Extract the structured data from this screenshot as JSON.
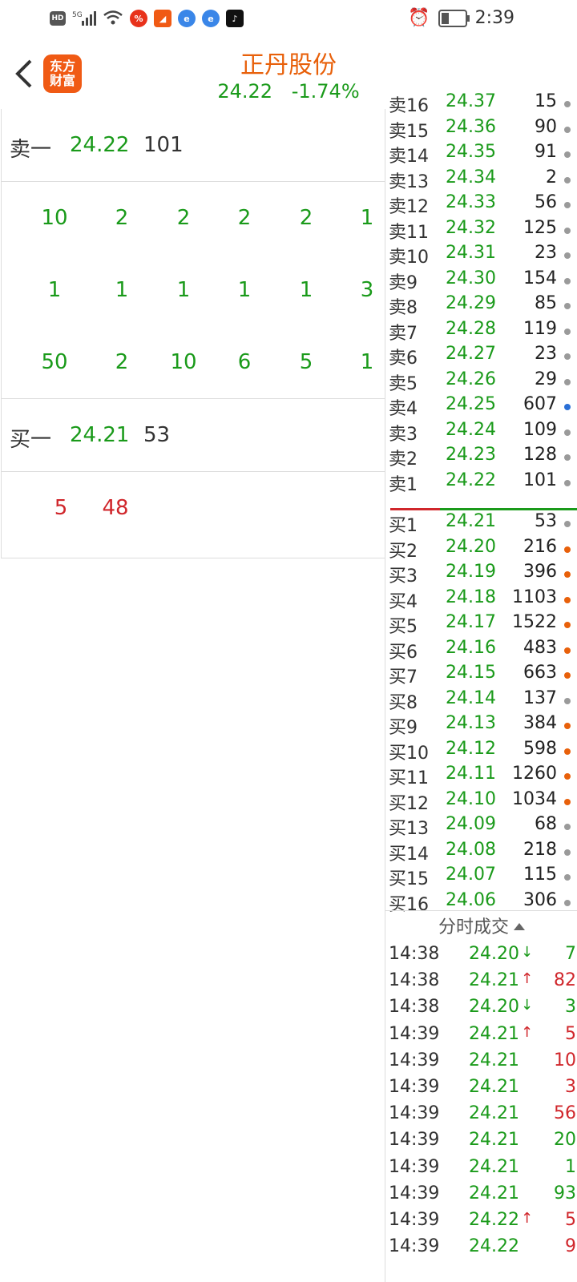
{
  "status_bar": {
    "time": "2:39",
    "left_icons": [
      "hd-icon",
      "5g-signal-icon",
      "wifi-icon",
      "app-icon-1",
      "app-icon-2",
      "app-icon-3",
      "app-icon-4",
      "tiktok-icon"
    ],
    "right_icons": [
      "alarm-icon",
      "battery-icon"
    ]
  },
  "header": {
    "logo_text": "东方\n财富",
    "title": "正丹股份",
    "price": "24.22",
    "change": "-1.74%",
    "title_color": "#e8600a",
    "price_color": "#1a9a1a"
  },
  "left_panel": {
    "sell_row": {
      "label": "卖一",
      "price": "24.22",
      "volume": "101"
    },
    "sell_queue": [
      [
        "10",
        "2",
        "2",
        "2",
        "2",
        "1"
      ],
      [
        "1",
        "1",
        "1",
        "1",
        "1",
        "3"
      ],
      [
        "50",
        "2",
        "10",
        "6",
        "5",
        "1"
      ]
    ],
    "buy_row": {
      "label": "买一",
      "price": "24.21",
      "volume": "53"
    },
    "buy_queue": [
      [
        "5",
        "48"
      ]
    ]
  },
  "order_book": {
    "sells": [
      {
        "label": "卖16",
        "price": "24.37",
        "volume": "15",
        "dot": "gray"
      },
      {
        "label": "卖15",
        "price": "24.36",
        "volume": "90",
        "dot": "gray"
      },
      {
        "label": "卖14",
        "price": "24.35",
        "volume": "91",
        "dot": "gray"
      },
      {
        "label": "卖13",
        "price": "24.34",
        "volume": "2",
        "dot": "gray"
      },
      {
        "label": "卖12",
        "price": "24.33",
        "volume": "56",
        "dot": "gray"
      },
      {
        "label": "卖11",
        "price": "24.32",
        "volume": "125",
        "dot": "gray"
      },
      {
        "label": "卖10",
        "price": "24.31",
        "volume": "23",
        "dot": "gray"
      },
      {
        "label": "卖9",
        "price": "24.30",
        "volume": "154",
        "dot": "gray"
      },
      {
        "label": "卖8",
        "price": "24.29",
        "volume": "85",
        "dot": "gray"
      },
      {
        "label": "卖7",
        "price": "24.28",
        "volume": "119",
        "dot": "gray"
      },
      {
        "label": "卖6",
        "price": "24.27",
        "volume": "23",
        "dot": "gray"
      },
      {
        "label": "卖5",
        "price": "24.26",
        "volume": "29",
        "dot": "gray"
      },
      {
        "label": "卖4",
        "price": "24.25",
        "volume": "607",
        "dot": "blue"
      },
      {
        "label": "卖3",
        "price": "24.24",
        "volume": "109",
        "dot": "gray"
      },
      {
        "label": "卖2",
        "price": "24.23",
        "volume": "128",
        "dot": "gray"
      },
      {
        "label": "卖1",
        "price": "24.22",
        "volume": "101",
        "dot": "gray"
      }
    ],
    "buys": [
      {
        "label": "买1",
        "price": "24.21",
        "volume": "53",
        "dot": "gray"
      },
      {
        "label": "买2",
        "price": "24.20",
        "volume": "216",
        "dot": "orange"
      },
      {
        "label": "买3",
        "price": "24.19",
        "volume": "396",
        "dot": "orange"
      },
      {
        "label": "买4",
        "price": "24.18",
        "volume": "1103",
        "dot": "orange"
      },
      {
        "label": "买5",
        "price": "24.17",
        "volume": "1522",
        "dot": "orange"
      },
      {
        "label": "买6",
        "price": "24.16",
        "volume": "483",
        "dot": "orange"
      },
      {
        "label": "买7",
        "price": "24.15",
        "volume": "663",
        "dot": "orange"
      },
      {
        "label": "买8",
        "price": "24.14",
        "volume": "137",
        "dot": "gray"
      },
      {
        "label": "买9",
        "price": "24.13",
        "volume": "384",
        "dot": "orange"
      },
      {
        "label": "买10",
        "price": "24.12",
        "volume": "598",
        "dot": "orange"
      },
      {
        "label": "买11",
        "price": "24.11",
        "volume": "1260",
        "dot": "orange"
      },
      {
        "label": "买12",
        "price": "24.10",
        "volume": "1034",
        "dot": "orange"
      },
      {
        "label": "买13",
        "price": "24.09",
        "volume": "68",
        "dot": "gray"
      },
      {
        "label": "买14",
        "price": "24.08",
        "volume": "218",
        "dot": "gray"
      },
      {
        "label": "买15",
        "price": "24.07",
        "volume": "115",
        "dot": "gray"
      },
      {
        "label": "买16",
        "price": "24.06",
        "volume": "306",
        "dot": "gray"
      }
    ],
    "dot_colors": {
      "gray": "#9a9a9a",
      "blue": "#2a6fd6",
      "orange": "#e8600a"
    }
  },
  "time_sales": {
    "title": "分时成交",
    "rows": [
      {
        "time": "14:38",
        "price": "24.20",
        "arrow": "↓",
        "volume": "7",
        "color": "#1a9a1a"
      },
      {
        "time": "14:38",
        "price": "24.21",
        "arrow": "↑",
        "volume": "82",
        "color": "#d0262b"
      },
      {
        "time": "14:38",
        "price": "24.20",
        "arrow": "↓",
        "volume": "3",
        "color": "#1a9a1a"
      },
      {
        "time": "14:39",
        "price": "24.21",
        "arrow": "↑",
        "volume": "5",
        "color": "#d0262b"
      },
      {
        "time": "14:39",
        "price": "24.21",
        "arrow": "",
        "volume": "10",
        "color": "#d0262b"
      },
      {
        "time": "14:39",
        "price": "24.21",
        "arrow": "",
        "volume": "3",
        "color": "#d0262b"
      },
      {
        "time": "14:39",
        "price": "24.21",
        "arrow": "",
        "volume": "56",
        "color": "#d0262b"
      },
      {
        "time": "14:39",
        "price": "24.21",
        "arrow": "",
        "volume": "20",
        "color": "#1a9a1a"
      },
      {
        "time": "14:39",
        "price": "24.21",
        "arrow": "",
        "volume": "1",
        "color": "#1a9a1a"
      },
      {
        "time": "14:39",
        "price": "24.21",
        "arrow": "",
        "volume": "93",
        "color": "#1a9a1a"
      },
      {
        "time": "14:39",
        "price": "24.22",
        "arrow": "↑",
        "volume": "5",
        "color": "#d0262b"
      },
      {
        "time": "14:39",
        "price": "24.22",
        "arrow": "",
        "volume": "9",
        "color": "#d0262b"
      }
    ]
  }
}
